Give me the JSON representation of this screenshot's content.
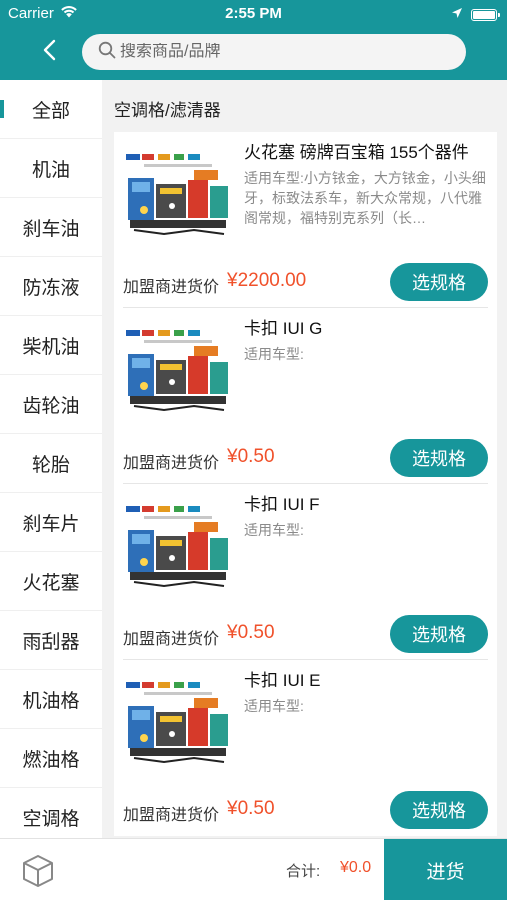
{
  "status_bar": {
    "carrier": "Carrier",
    "time": "2:55 PM"
  },
  "search": {
    "placeholder": "搜索商品/品牌"
  },
  "sidebar": {
    "items": [
      {
        "label": "全部",
        "active": true
      },
      {
        "label": "机油"
      },
      {
        "label": "刹车油"
      },
      {
        "label": "防冻液"
      },
      {
        "label": "柴机油"
      },
      {
        "label": "齿轮油"
      },
      {
        "label": "轮胎"
      },
      {
        "label": "刹车片"
      },
      {
        "label": "火花塞"
      },
      {
        "label": "雨刮器"
      },
      {
        "label": "机油格"
      },
      {
        "label": "燃油格"
      },
      {
        "label": "空调格"
      }
    ]
  },
  "main": {
    "section_title": "空调格/滤清器",
    "products": [
      {
        "name": "火花塞 磅牌百宝箱 155个器件",
        "desc": "适用车型:小方铱金，大方铱金，小头细牙，标致法系车，新大众常规，八代雅阁常规，福特别克系列（长…",
        "price_label": "加盟商进货价",
        "price": "¥2200.00",
        "button": "选规格"
      },
      {
        "name": "卡扣  IUI G",
        "desc": "适用车型:",
        "price_label": "加盟商进货价",
        "price": "¥0.50",
        "button": "选规格"
      },
      {
        "name": "卡扣  IUI F",
        "desc": "适用车型:",
        "price_label": "加盟商进货价",
        "price": "¥0.50",
        "button": "选规格"
      },
      {
        "name": "卡扣  IUI E",
        "desc": "适用车型:",
        "price_label": "加盟商进货价",
        "price": "¥0.50",
        "button": "选规格"
      }
    ]
  },
  "bottom_bar": {
    "total_label": "合计:",
    "total_value": "¥0.0",
    "checkout_label": "进货"
  },
  "colors": {
    "accent": "#17969b",
    "price": "#f0512b"
  },
  "icons": {
    "back": "chevron-left-icon",
    "search": "search-icon",
    "cart": "box-icon"
  }
}
